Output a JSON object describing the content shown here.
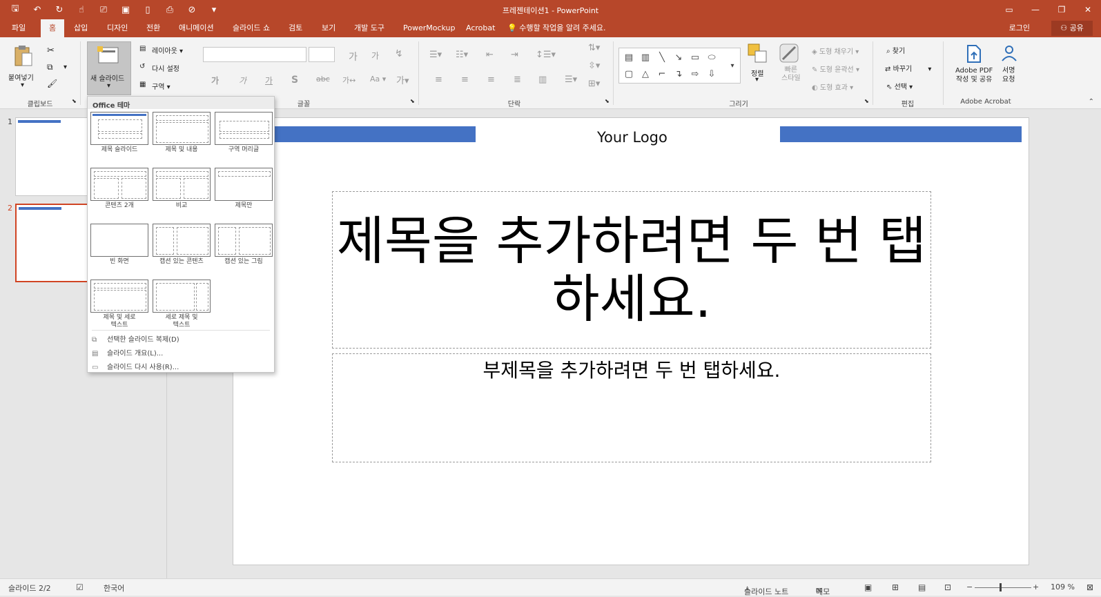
{
  "window": {
    "title": "프레젠테이션1 - PowerPoint"
  },
  "tabs": [
    "파일",
    "홈",
    "삽입",
    "디자인",
    "전환",
    "애니메이션",
    "슬라이드 쇼",
    "검토",
    "보기",
    "개발 도구",
    "PowerMockup",
    "Acrobat"
  ],
  "active_tab": "홈",
  "tell_me": "수행할 작업을 알려 주세요.",
  "login": "로그인",
  "share": "공유",
  "ribbon": {
    "clipboard": {
      "paste": "붙여넣기",
      "group": "클립보드"
    },
    "slides": {
      "new_slide": "새 슬라이드",
      "layout": "레이아웃",
      "reset": "다시 설정",
      "section": "구역"
    },
    "font": {
      "group": "글꼴"
    },
    "paragraph": {
      "group": "단락"
    },
    "drawing": {
      "arrange": "정렬",
      "quick_styles": "빠른\n스타일",
      "fill": "도형 채우기",
      "outline": "도형 윤곽선",
      "effects": "도형 효과",
      "group": "그리기"
    },
    "editing": {
      "find": "찾기",
      "replace": "바꾸기",
      "select": "선택",
      "group": "편집"
    },
    "acrobat": {
      "create_pdf_l1": "Adobe PDF",
      "create_pdf_l2": "작성 및 공유",
      "sign_l1": "서명",
      "sign_l2": "요청",
      "group": "Adobe Acrobat"
    }
  },
  "gallery": {
    "header": "Office 테마",
    "layouts": [
      "제목 슬라이드",
      "제목 및 내용",
      "구역 머리글",
      "콘텐츠 2개",
      "비교",
      "제목만",
      "빈 화면",
      "캡션 있는 콘텐츠",
      "캡션 있는 그림",
      "제목 및 세로\n텍스트",
      "세로 제목 및\n텍스트"
    ],
    "actions": [
      "선택한 슬라이드 복제(D)",
      "슬라이드 개요(L)...",
      "슬라이드 다시 사용(R)..."
    ]
  },
  "thumbnails": [
    "1",
    "2"
  ],
  "slide": {
    "logo": "Your Logo",
    "title": "제목을 추가하려면 두 번 탭하세요.",
    "subtitle": "부제목을 추가하려면 두 번 탭하세요."
  },
  "status": {
    "slide_count": "슬라이드 2/2",
    "language": "한국어",
    "notes": "슬라이드 노트",
    "comments": "메모",
    "zoom": "109 %"
  },
  "colors": {
    "accent": "#b7472a",
    "selected": "#d04423",
    "blue_bar": "#4472c4"
  }
}
